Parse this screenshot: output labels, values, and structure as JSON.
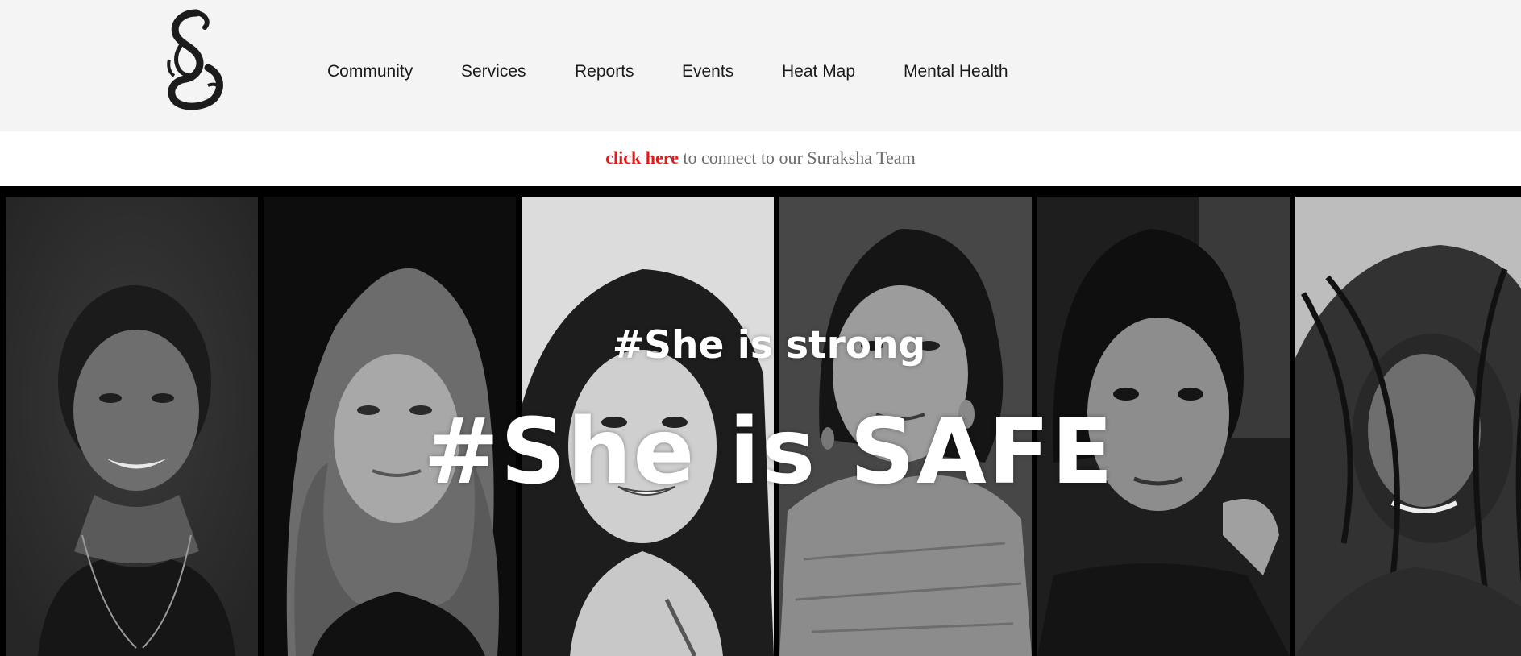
{
  "nav": {
    "items": [
      {
        "label": "Community"
      },
      {
        "label": "Services"
      },
      {
        "label": "Reports"
      },
      {
        "label": "Events"
      },
      {
        "label": "Heat Map"
      },
      {
        "label": "Mental Health"
      }
    ]
  },
  "banner": {
    "link_text": "click here",
    "rest_text": " to connect to our Suraksha Team"
  },
  "hero": {
    "subtitle": "#She is strong",
    "title": "#She is SAFE",
    "panels": [
      {
        "name": "woman-portrait-1"
      },
      {
        "name": "woman-portrait-2"
      },
      {
        "name": "woman-portrait-3"
      },
      {
        "name": "woman-portrait-4"
      },
      {
        "name": "woman-portrait-5"
      },
      {
        "name": "woman-portrait-6"
      }
    ]
  },
  "colors": {
    "header_bg": "#f4f4f4",
    "link_red": "#e11a1a",
    "banner_text": "#6b6b6b",
    "hero_bg": "#000000"
  }
}
